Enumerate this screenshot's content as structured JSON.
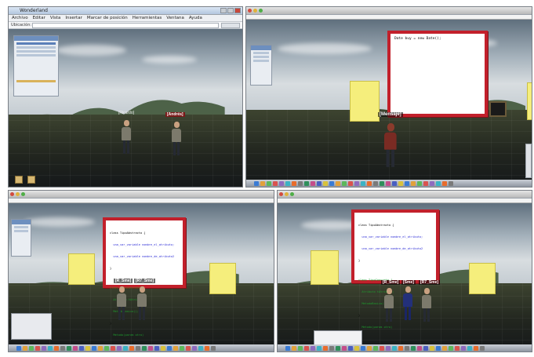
{
  "panel1": {
    "window_title": "Wonderland",
    "menu_items": [
      "Archivo",
      "Editar",
      "Vista",
      "Insertar",
      "Marcar de posición",
      "Herramientas",
      "Ventana",
      "Ayuda"
    ],
    "url_label": "Ubicación:",
    "avatar_a_name": "[Ricardo]",
    "avatar_b_name": "[Andrés]"
  },
  "panel2": {
    "board_text": "Date buy = new Date();",
    "avatar_name": "[Mensaje]"
  },
  "panel3": {
    "board_lines": [
      {
        "text": "class TipoAbstracto {",
        "color": "black"
      },
      {
        "text": "  una_var_variable nombre_el_atributo;",
        "color": "blue"
      },
      {
        "text": "  una_var_variable nombre_de_atributo2",
        "color": "blue"
      },
      {
        "text": "}",
        "color": "black"
      },
      {
        "text": "",
        "color": "black"
      },
      {
        "text": "class TipoConcreto {",
        "color": "green"
      },
      {
        "text": "  Atributo tAtributo;",
        "color": "green"
      },
      {
        "text": "  MetodoBasico();",
        "color": "green"
      },
      {
        "text": "}",
        "color": "black"
      },
      {
        "text": "  Metodo(param otro)",
        "color": "green"
      }
    ],
    "avatar_a_name": "[R_Sme]",
    "avatar_b_name": "[R7_Sme]"
  },
  "panel4": {
    "board_lines": [
      {
        "text": "class TipoAbstracto {",
        "color": "black"
      },
      {
        "text": "  una_var_variable nombre_el_atributo;",
        "color": "blue"
      },
      {
        "text": "  una_var_variable nombre_de_atributo2",
        "color": "blue"
      },
      {
        "text": "}",
        "color": "black"
      },
      {
        "text": "",
        "color": "black"
      },
      {
        "text": "class TipoConcreto {",
        "color": "green"
      },
      {
        "text": "  Atributo tAtributo;",
        "color": "green"
      },
      {
        "text": "  MetodoBasico();",
        "color": "green"
      },
      {
        "text": "}",
        "color": "black"
      },
      {
        "text": "  Metodo(param otro)",
        "color": "green"
      }
    ],
    "avatar_a_name": "[R_Sme]",
    "avatar_b_name": "[Sme]",
    "avatar_c_name": "[R7_Sme]"
  },
  "colors": {
    "board_border": "#c2202b",
    "sticky": "#f5ee7c",
    "code_blue": "#2b2bd6",
    "code_green": "#1e9c2e"
  },
  "dock_colors": [
    "#3a7bd5",
    "#e2a13b",
    "#5cb85c",
    "#d9534f",
    "#8e6bbf",
    "#3bb3c4",
    "#e86c2c",
    "#7a7a7a",
    "#2f8f5b",
    "#c44d8a",
    "#4a5fc1",
    "#d8c23c",
    "#3a7bd5",
    "#e2a13b",
    "#5cb85c",
    "#d9534f",
    "#8e6bbf",
    "#3bb3c4",
    "#e86c2c",
    "#7a7a7a",
    "#2f8f5b",
    "#c44d8a",
    "#4a5fc1",
    "#d8c23c",
    "#3a7bd5",
    "#e2a13b",
    "#5cb85c",
    "#d9534f",
    "#8e6bbf",
    "#3bb3c4",
    "#e86c2c",
    "#7a7a7a"
  ]
}
